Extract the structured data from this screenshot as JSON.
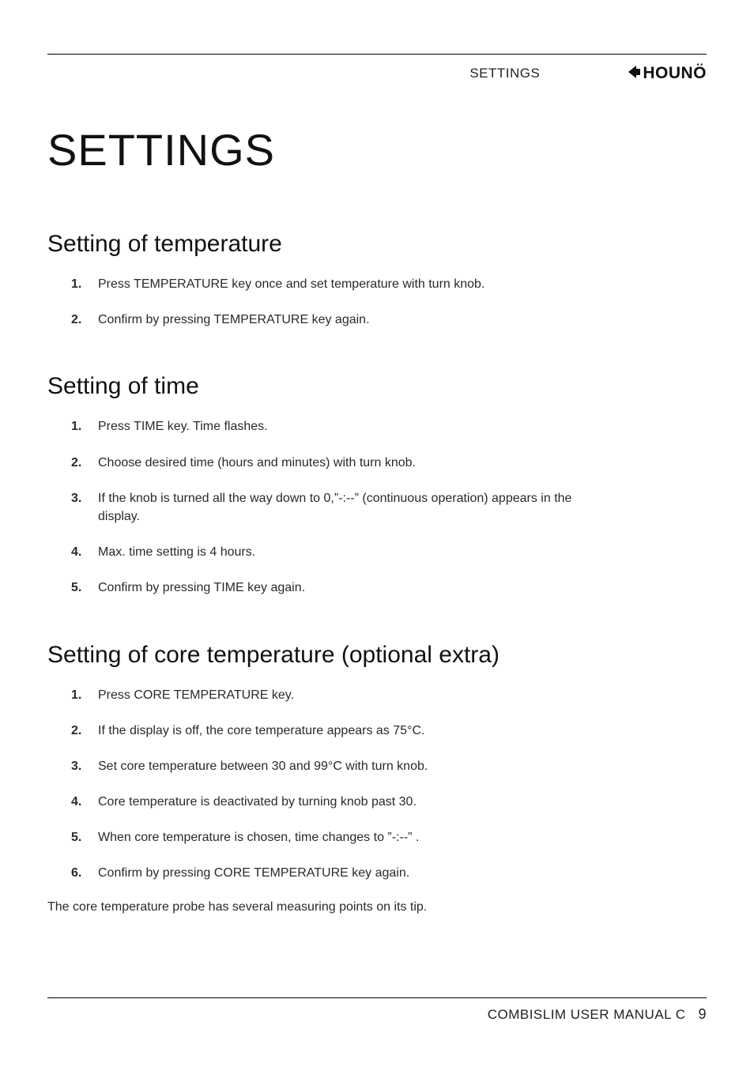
{
  "header": {
    "section_label": "SETTINGS",
    "logo_text": "HOUNÖ"
  },
  "title": "SETTINGS",
  "sections": [
    {
      "heading": "Setting of temperature",
      "steps": [
        "Press TEMPERATURE key once and set temperature with turn knob.",
        "Confirm by pressing TEMPERATURE key again."
      ]
    },
    {
      "heading": "Setting of time",
      "steps": [
        "Press TIME key. Time flashes.",
        "Choose desired time (hours and minutes) with turn knob.",
        "If the knob is turned all the way down to 0,”-:--” (continuous operation) appears in the display.",
        "Max. time setting is 4 hours.",
        "Confirm by pressing TIME key again."
      ]
    },
    {
      "heading": "Setting of core temperature (optional extra)",
      "steps": [
        "Press CORE TEMPERATURE key.",
        "If the display is off, the core temperature appears as 75°C.",
        "Set core temperature between 30 and 99°C with turn knob.",
        "Core temperature is deactivated by turning knob past 30.",
        "When core temperature is chosen, time changes to ”-:--” .",
        "Confirm by pressing CORE TEMPERATURE key again."
      ],
      "trailing_paragraph": "The core temperature probe has several measuring points on its tip."
    }
  ],
  "footer": {
    "manual_title": "COMBISLIM USER MANUAL C",
    "page_number": "9"
  }
}
